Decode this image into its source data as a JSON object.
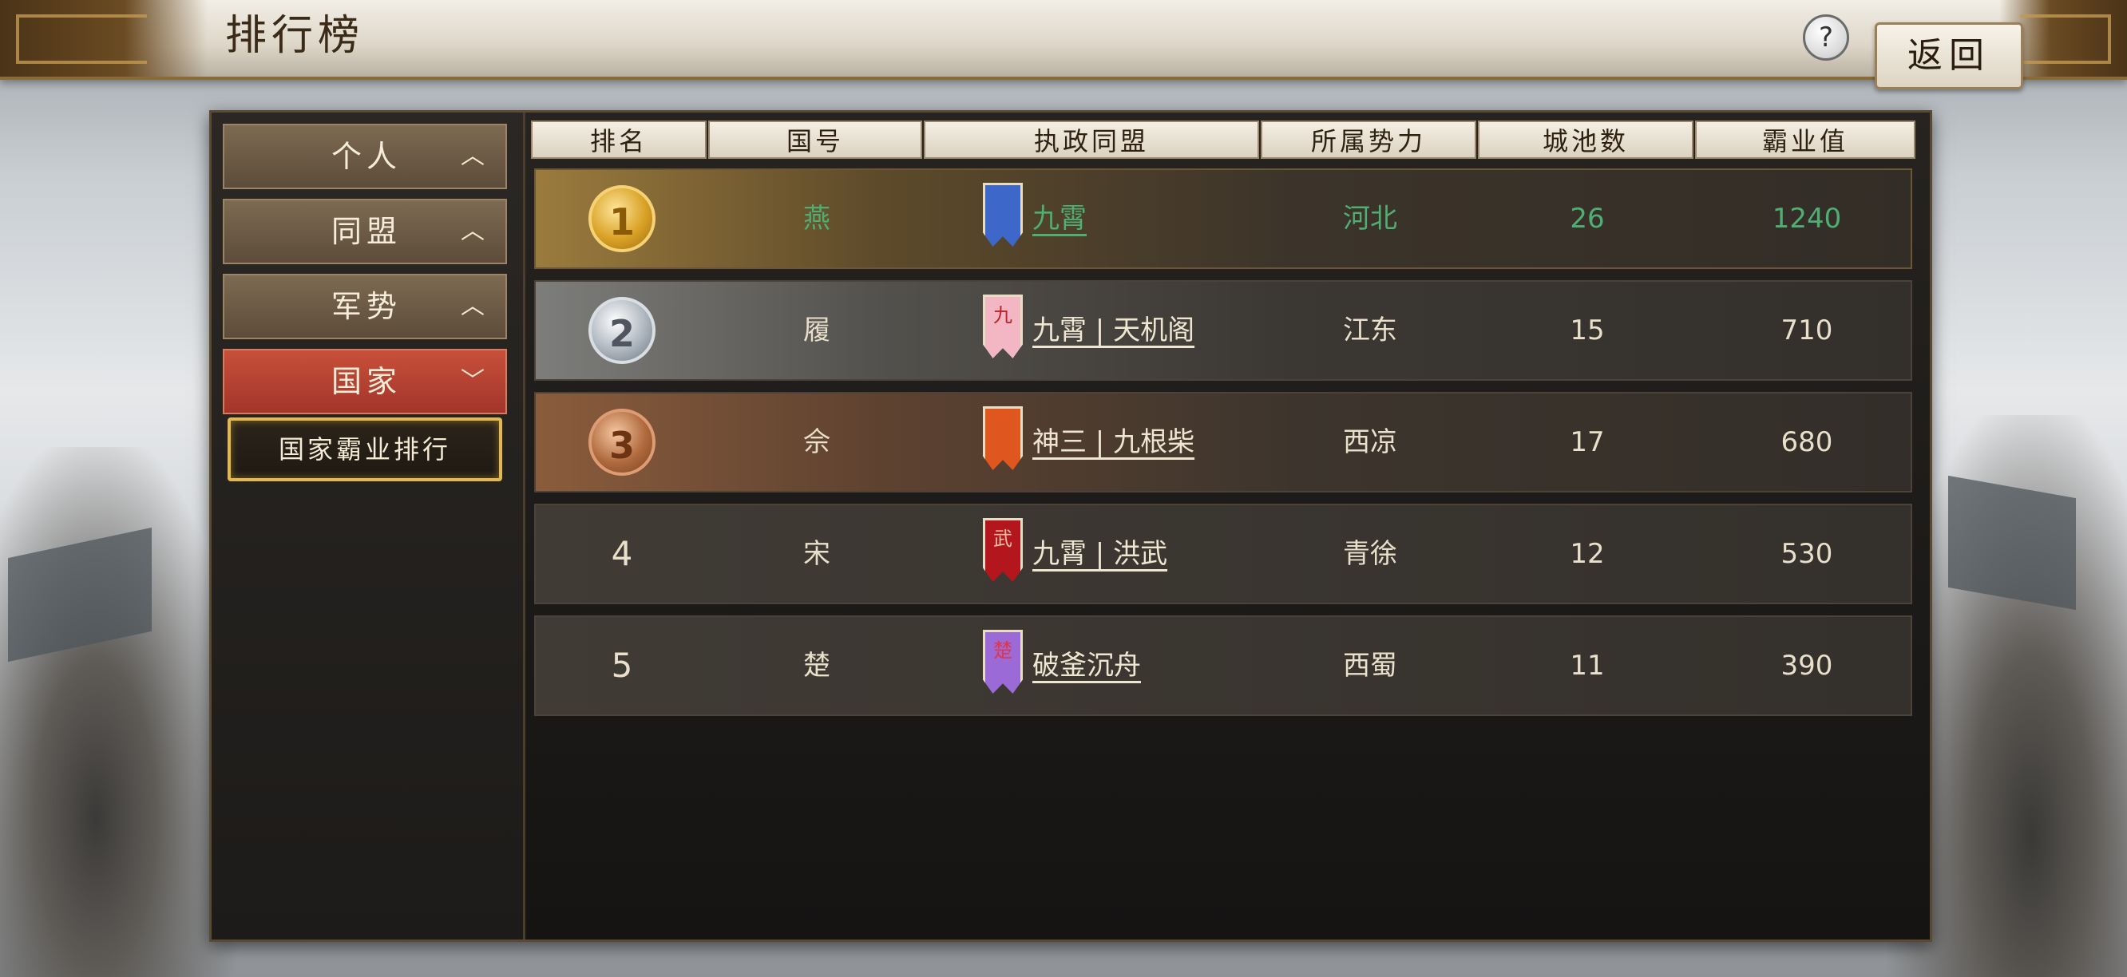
{
  "header": {
    "title": "排行榜",
    "help_label": "?",
    "back_label": "返回"
  },
  "sidebar": {
    "tabs": [
      {
        "label": "个人",
        "chevron": "up"
      },
      {
        "label": "同盟",
        "chevron": "up"
      },
      {
        "label": "军势",
        "chevron": "up"
      },
      {
        "label": "国家",
        "chevron": "down",
        "active": true
      }
    ],
    "sub_item": "国家霸业排行"
  },
  "table": {
    "columns": [
      "排名",
      "国号",
      "执政同盟",
      "所属势力",
      "城池数",
      "霸业值"
    ],
    "rows": [
      {
        "rank": "1",
        "medal": "gold",
        "country": "燕",
        "banner_char": "",
        "banner_color": "#3d67c9",
        "alliance": "九霄",
        "faction": "河北",
        "cities": "26",
        "value": "1240",
        "highlight": true
      },
      {
        "rank": "2",
        "medal": "silver",
        "country": "履",
        "banner_char": "九",
        "banner_color": "#f2b7c3",
        "alliance": "九霄 | 天机阁",
        "faction": "江东",
        "cities": "15",
        "value": "710"
      },
      {
        "rank": "3",
        "medal": "bronze",
        "country": "佘",
        "banner_char": "",
        "banner_color": "#e0561f",
        "alliance": "神三 | 九根柴",
        "faction": "西凉",
        "cities": "17",
        "value": "680"
      },
      {
        "rank": "4",
        "medal": "",
        "country": "宋",
        "banner_char": "武",
        "banner_color": "#b3161c",
        "alliance": "九霄 | 洪武",
        "faction": "青徐",
        "cities": "12",
        "value": "530"
      },
      {
        "rank": "5",
        "medal": "",
        "country": "楚",
        "banner_char": "楚",
        "banner_color": "#9b6ad6",
        "alliance": "破釜沉舟",
        "faction": "西蜀",
        "cities": "11",
        "value": "390"
      }
    ]
  },
  "icons": {
    "help": "question-mark-icon",
    "chevron_up": "chevron-up-icon",
    "chevron_down": "chevron-down-icon",
    "medals": [
      "gold-medal-icon",
      "silver-medal-icon",
      "bronze-medal-icon"
    ],
    "banner": "alliance-banner-icon"
  },
  "colors": {
    "accent_gold": "#e4b84a",
    "active_tab": "#b53f2f",
    "highlight_text": "#4fae73"
  }
}
